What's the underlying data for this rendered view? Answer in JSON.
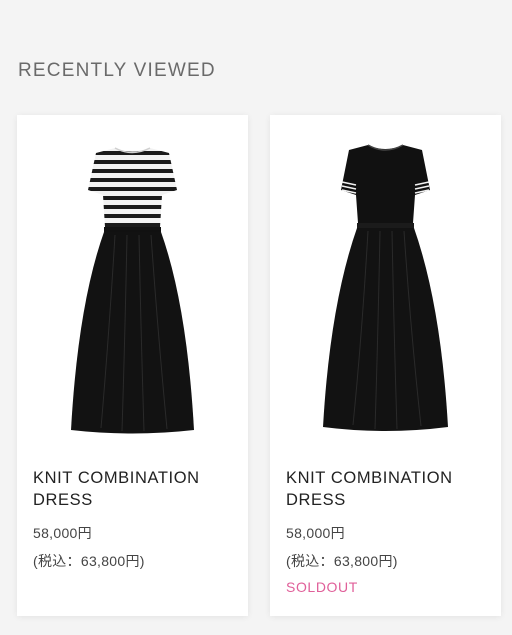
{
  "section": {
    "title": "RECENTLY VIEWED"
  },
  "products": [
    {
      "name": "KNIT COMBINATION DRESS",
      "price": "58,000円",
      "price_tax": "(税込：63,800円)",
      "status": "",
      "image_icon": "striped-knit-dress-image"
    },
    {
      "name": "KNIT COMBINATION DRESS",
      "price": "58,000円",
      "price_tax": "(税込：63,800円)",
      "status": "SOLDOUT",
      "image_icon": "black-knit-dress-image"
    }
  ],
  "colors": {
    "soldout": "#e0609a",
    "background": "#f4f4f4",
    "card": "#ffffff"
  }
}
